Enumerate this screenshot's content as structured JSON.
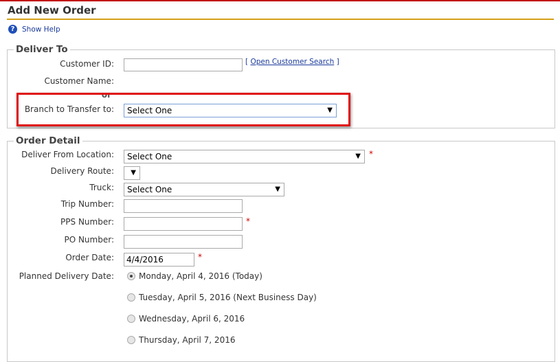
{
  "page": {
    "title": "Add New Order",
    "help_label": "Show Help"
  },
  "deliver_to": {
    "legend": "Deliver To",
    "customer_id_label": "Customer ID:",
    "customer_id_value": "",
    "customer_search_link": "Open Customer Search",
    "link_bracket_open": "[",
    "link_bracket_close": "]",
    "customer_name_label": "Customer Name:",
    "or_label": "or",
    "branch_label": "Branch to Transfer to:",
    "branch_value": "Select One"
  },
  "order_detail": {
    "legend": "Order Detail",
    "deliver_from_label": "Deliver From Location:",
    "deliver_from_value": "Select One",
    "delivery_route_label": "Delivery Route:",
    "delivery_route_value": "",
    "truck_label": "Truck:",
    "truck_value": "Select One",
    "trip_number_label": "Trip Number:",
    "trip_number_value": "",
    "pps_number_label": "PPS Number:",
    "pps_number_value": "",
    "po_number_label": "PO Number:",
    "po_number_value": "",
    "order_date_label": "Order Date:",
    "order_date_value": "4/4/2016",
    "planned_delivery_label": "Planned Delivery Date:",
    "required_marker": "*",
    "delivery_options": [
      {
        "label": "Monday, April 4, 2016 (Today)",
        "selected": true
      },
      {
        "label": "Tuesday, April 5, 2016 (Next Business Day)",
        "selected": false
      },
      {
        "label": "Wednesday, April 6, 2016",
        "selected": false
      },
      {
        "label": "Thursday, April 7, 2016",
        "selected": false
      }
    ]
  },
  "colors": {
    "header_rule": "#d4a017",
    "top_bar": "#c00000",
    "highlight": "#e01010",
    "required": "#d10000"
  },
  "icons": {
    "help": "help-circle-icon",
    "dropdown": "chevron-down-icon"
  }
}
